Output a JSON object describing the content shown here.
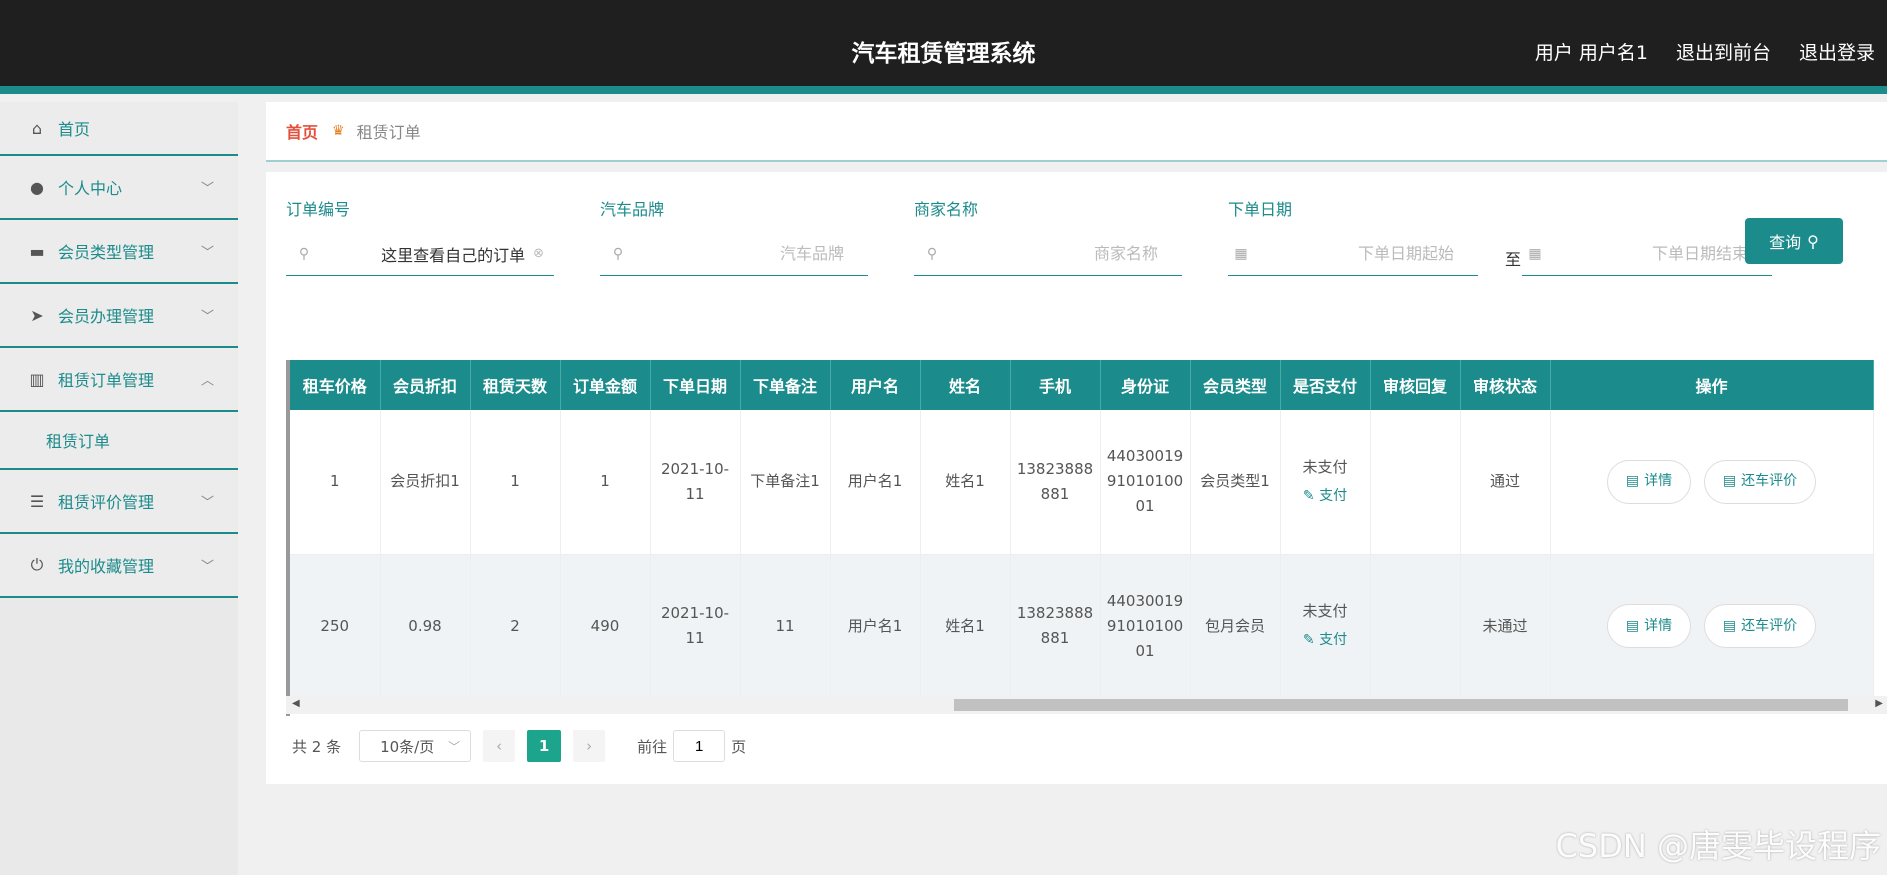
{
  "header": {
    "title": "汽车租赁管理系统",
    "user_label": "用户 用户名1",
    "back_front": "退出到前台",
    "logout": "退出登录"
  },
  "sidebar": {
    "items": [
      {
        "label": "首页",
        "icon": "home-icon"
      },
      {
        "label": "个人中心",
        "icon": "user-icon"
      },
      {
        "label": "会员类型管理",
        "icon": "card-icon"
      },
      {
        "label": "会员办理管理",
        "icon": "send-icon"
      },
      {
        "label": "租赁订单管理",
        "icon": "chart-icon",
        "expanded": true,
        "sub": "租赁订单"
      },
      {
        "label": "租赁评价管理",
        "icon": "sliders-icon"
      },
      {
        "label": "我的收藏管理",
        "icon": "power-icon"
      }
    ]
  },
  "breadcrumb": {
    "home": "首页",
    "current": "租赁订单"
  },
  "filters": {
    "order_no": {
      "label": "订单编号",
      "value": "这里查看自己的订单"
    },
    "brand": {
      "label": "汽车品牌",
      "placeholder": "汽车品牌"
    },
    "merchant": {
      "label": "商家名称",
      "placeholder": "商家名称"
    },
    "date": {
      "label": "下单日期",
      "start_placeholder": "下单日期起始",
      "end_placeholder": "下单日期结束",
      "to": "至"
    },
    "query_button": "查询"
  },
  "table": {
    "headers": [
      "租车价格",
      "会员折扣",
      "租赁天数",
      "订单金额",
      "下单日期",
      "下单备注",
      "用户名",
      "姓名",
      "手机",
      "身份证",
      "会员类型",
      "是否支付",
      "审核回复",
      "审核状态",
      "操作"
    ],
    "rows": [
      [
        "1",
        "会员折扣1",
        "1",
        "1",
        "2021-10-11",
        "下单备注1",
        "用户名1",
        "姓名1",
        "13823888881",
        "440300199101010001",
        "会员类型1",
        "未支付",
        "",
        "通过"
      ],
      [
        "250",
        "0.98",
        "2",
        "490",
        "2021-10-11",
        "11",
        "用户名1",
        "姓名1",
        "13823888881",
        "440300199101010001",
        "包月会员",
        "未支付",
        "",
        "未通过"
      ]
    ],
    "pay_link": "支付",
    "detail_button": "详情",
    "review_button": "还车评价"
  },
  "pager": {
    "total": "共 2 条",
    "page_size": "10条/页",
    "current_page": "1",
    "goto_prefix": "前往",
    "goto_value": "1",
    "goto_suffix": "页"
  },
  "watermark": "CSDN @唐雯毕设程序"
}
